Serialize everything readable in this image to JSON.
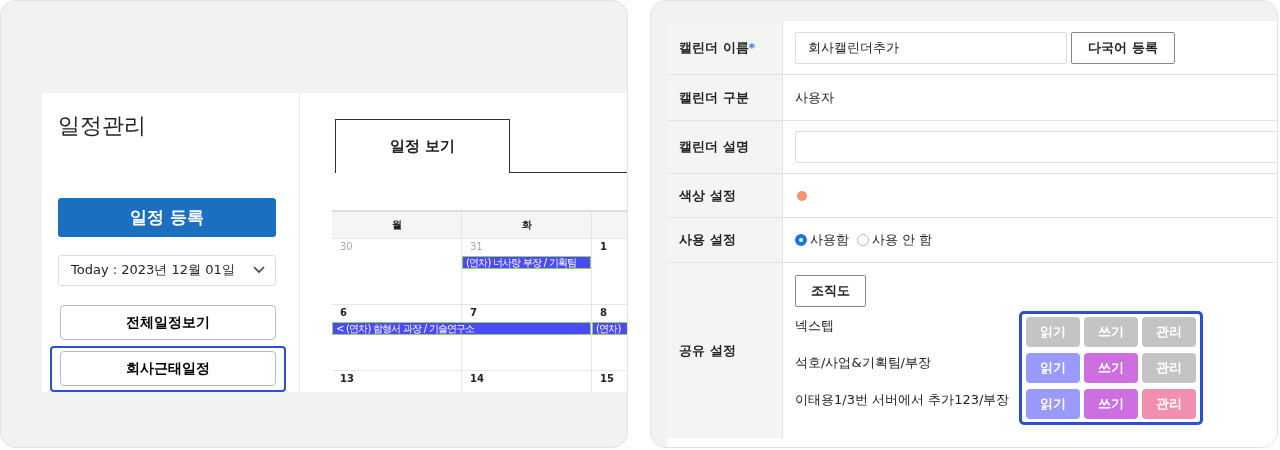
{
  "left_panel": {
    "sidebar": {
      "title": "일정관리",
      "register_button": "일정 등록",
      "date_select": {
        "value": "Today : 2023년 12월 01일"
      },
      "buttons": [
        {
          "label": "전체일정보기",
          "highlighted": false
        },
        {
          "label": "회사근태일정",
          "highlighted": true
        }
      ]
    },
    "tabs": [
      {
        "label": "일정 보기",
        "selected": true
      }
    ],
    "calendar": {
      "weekdays": [
        "월",
        "화"
      ],
      "weeks": [
        {
          "days": [
            {
              "day": "30",
              "other_month": true
            },
            {
              "day": "31",
              "other_month": true,
              "event": {
                "label": "(연차) 너사랑 부장 / 기획팀",
                "spans_next_day": false
              }
            },
            {
              "day": "1",
              "other_month": false
            }
          ]
        },
        {
          "days": [
            {
              "day": "6",
              "other_month": false,
              "event": {
                "label": "< (연차) 함형서 과장 / 기술연구소",
                "spans_next_day": true
              }
            },
            {
              "day": "7",
              "other_month": false
            },
            {
              "day": "8",
              "other_month": false,
              "event": {
                "label": "(연차)",
                "spans_next_day": false
              }
            }
          ]
        },
        {
          "days": [
            {
              "day": "13",
              "other_month": false
            },
            {
              "day": "14",
              "other_month": false
            },
            {
              "day": "15",
              "other_month": false
            }
          ]
        }
      ]
    }
  },
  "form": {
    "name": {
      "label": "캘린더 이름",
      "required_mark": "*",
      "value": "회사캘린더추가",
      "button": "다국어 등록"
    },
    "type": {
      "label": "캘린더 구분",
      "value": "사용자"
    },
    "description": {
      "label": "캘린더 설명"
    },
    "color": {
      "label": "색상 설정",
      "color": "#f4956c"
    },
    "usage": {
      "label": "사용 설정",
      "options": [
        {
          "label": "사용함",
          "selected": true
        },
        {
          "label": "사용 안 함",
          "selected": false
        }
      ]
    },
    "share": {
      "label": "공유 설정",
      "org_button": "조직도",
      "highlighted": true,
      "members": [
        {
          "name": "넥스텝",
          "permissions": [
            {
              "label": "읽기",
              "kind": "read",
              "on": false
            },
            {
              "label": "쓰기",
              "kind": "write",
              "on": false
            },
            {
              "label": "관리",
              "kind": "manage",
              "on": false
            }
          ]
        },
        {
          "name": "석호/사업&기획팀/부장",
          "permissions": [
            {
              "label": "읽기",
              "kind": "read",
              "on": true
            },
            {
              "label": "쓰기",
              "kind": "write",
              "on": true
            },
            {
              "label": "관리",
              "kind": "manage",
              "on": false
            }
          ]
        },
        {
          "name": "이태용1/3번 서버에서 추가123/부장",
          "permissions": [
            {
              "label": "읽기",
              "kind": "read",
              "on": true
            },
            {
              "label": "쓰기",
              "kind": "write",
              "on": true
            },
            {
              "label": "관리",
              "kind": "manage",
              "on": true
            }
          ]
        }
      ]
    }
  }
}
